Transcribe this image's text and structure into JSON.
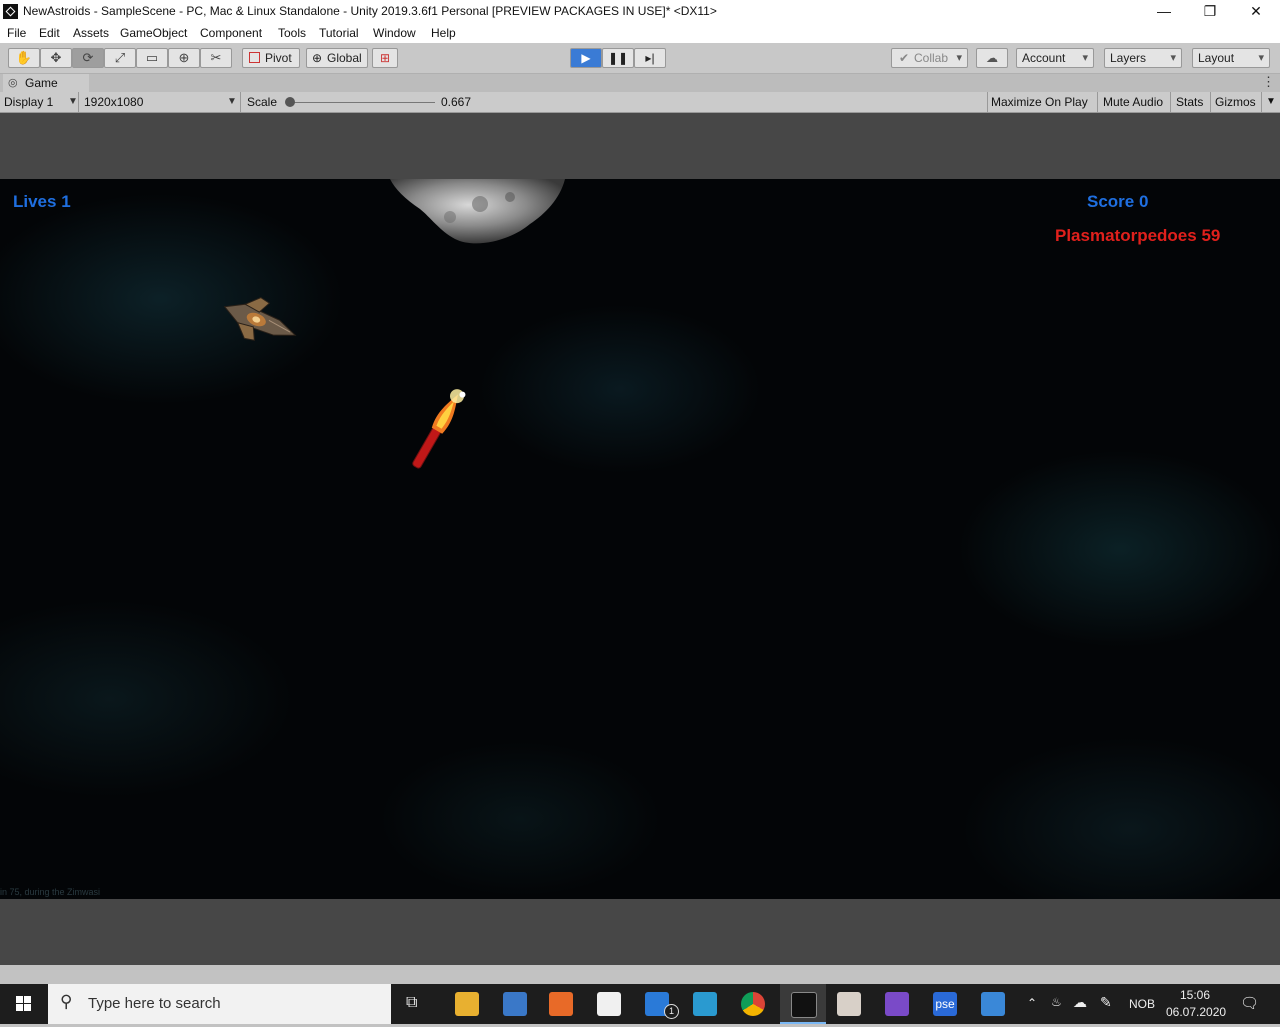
{
  "window": {
    "title": "NewAstroids - SampleScene - PC, Mac & Linux Standalone - Unity 2019.3.6f1 Personal [PREVIEW PACKAGES IN USE]* <DX11>",
    "minimize": "—",
    "restore": "❐",
    "close": "✕"
  },
  "menu": [
    "File",
    "Edit",
    "Assets",
    "GameObject",
    "Component",
    "Tools",
    "Tutorial",
    "Window",
    "Help"
  ],
  "toolbar": {
    "pivot_label": "Pivot",
    "global_label": "Global",
    "collab_label": "Collab",
    "account_label": "Account",
    "layers_label": "Layers",
    "layout_label": "Layout"
  },
  "game_tab": {
    "label": "Game",
    "display": "Display 1",
    "resolution": "1920x1080",
    "scale_label": "Scale",
    "scale_value": "0.667",
    "maximize_label": "Maximize On Play",
    "mute_label": "Mute Audio",
    "stats_label": "Stats",
    "gizmos_label": "Gizmos"
  },
  "hud": {
    "lives": "Lives 1",
    "score": "Score 0",
    "torpedoes": "Plasmatorpedoes 59",
    "footnote": "in 75, during the Zimwasi"
  },
  "taskbar": {
    "search_placeholder": "Type here to search",
    "language": "NOB",
    "time": "15:06",
    "date": "06.07.2020",
    "mail_badge": "1"
  }
}
